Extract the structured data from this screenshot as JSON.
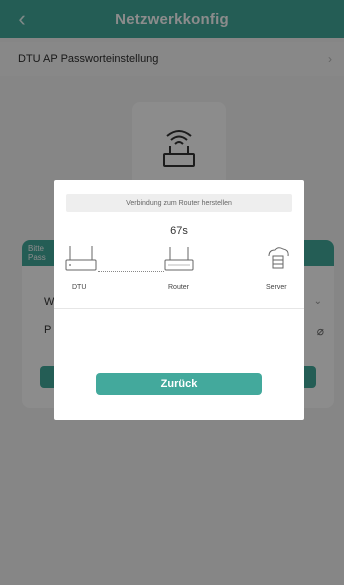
{
  "header": {
    "back_icon": "chevron-left-icon",
    "title": "Netzwerkkonfig"
  },
  "settings_row": {
    "label": "DTU AP Passworteinstellung",
    "chevron_icon": "chevron-right-icon"
  },
  "background_panel": {
    "hint_text": "Bitte\nPass",
    "wifi_label": "W",
    "password_label": "P"
  },
  "modal": {
    "status_text": "Verbindung zum Router herstellen",
    "countdown": "67s",
    "devices": [
      {
        "label": "DTU",
        "icon": "dtu-device-icon"
      },
      {
        "label": "Router",
        "icon": "router-icon"
      },
      {
        "label": "Server",
        "icon": "cloud-server-icon"
      }
    ],
    "back_button_label": "Zurück"
  },
  "colors": {
    "accent": "#43a99c"
  }
}
